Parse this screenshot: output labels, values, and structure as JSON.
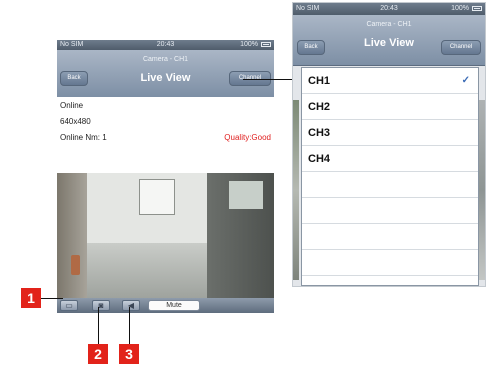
{
  "left_screen": {
    "status": {
      "carrier": "No SIM",
      "time": "20:43",
      "battery": "100%"
    },
    "nav": {
      "subtitle": "Camera - CH1",
      "title": "Live View",
      "back_label": "Back",
      "channel_label": "Channel"
    },
    "info": {
      "status": "Online",
      "resolution": "640x480",
      "online_num": "Online Nm: 1",
      "quality": "Quality:Good"
    },
    "toolbar": {
      "mute_label": "Mute",
      "icon_1": "snapshot-icon",
      "icon_2": "record-icon",
      "icon_3": "speaker-icon"
    }
  },
  "markers": [
    "1",
    "2",
    "3"
  ],
  "right_screen": {
    "status": {
      "carrier": "No SIM",
      "time": "20:43",
      "battery": "100%"
    },
    "nav": {
      "subtitle": "Camera - CH1",
      "title": "Live View",
      "back_label": "Back",
      "channel_label": "Channel"
    },
    "channels": [
      {
        "label": "CH1",
        "selected": true,
        "check": "✓"
      },
      {
        "label": "CH2",
        "selected": false
      },
      {
        "label": "CH3",
        "selected": false
      },
      {
        "label": "CH4",
        "selected": false
      }
    ]
  },
  "colors": {
    "marker": "#e2231a",
    "quality": "#e02020",
    "check": "#3b6bb5"
  }
}
